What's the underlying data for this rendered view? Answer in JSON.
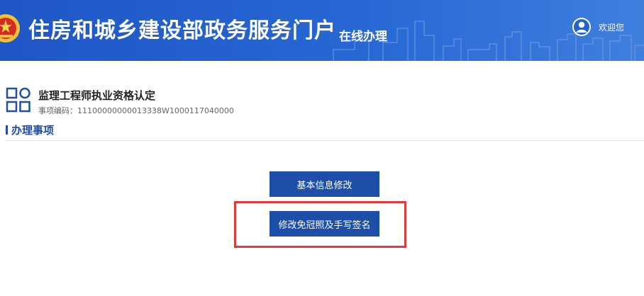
{
  "header": {
    "portal_title": "住房和城乡建设部政务服务门户",
    "sub_title": "在线办理",
    "welcome_text": "欢迎您",
    "background_color": "#2262cf"
  },
  "item": {
    "title": "监理工程师执业资格认定",
    "code_label": "事项编码：",
    "code_value": "11100000000013338W1000117040000"
  },
  "section": {
    "title": "办理事项"
  },
  "actions": {
    "basic_info_label": "基本信息修改",
    "photo_signature_label": "修改免冠照及手写签名",
    "button_color": "#1d4fa8",
    "highlight_color": "#e53935"
  }
}
